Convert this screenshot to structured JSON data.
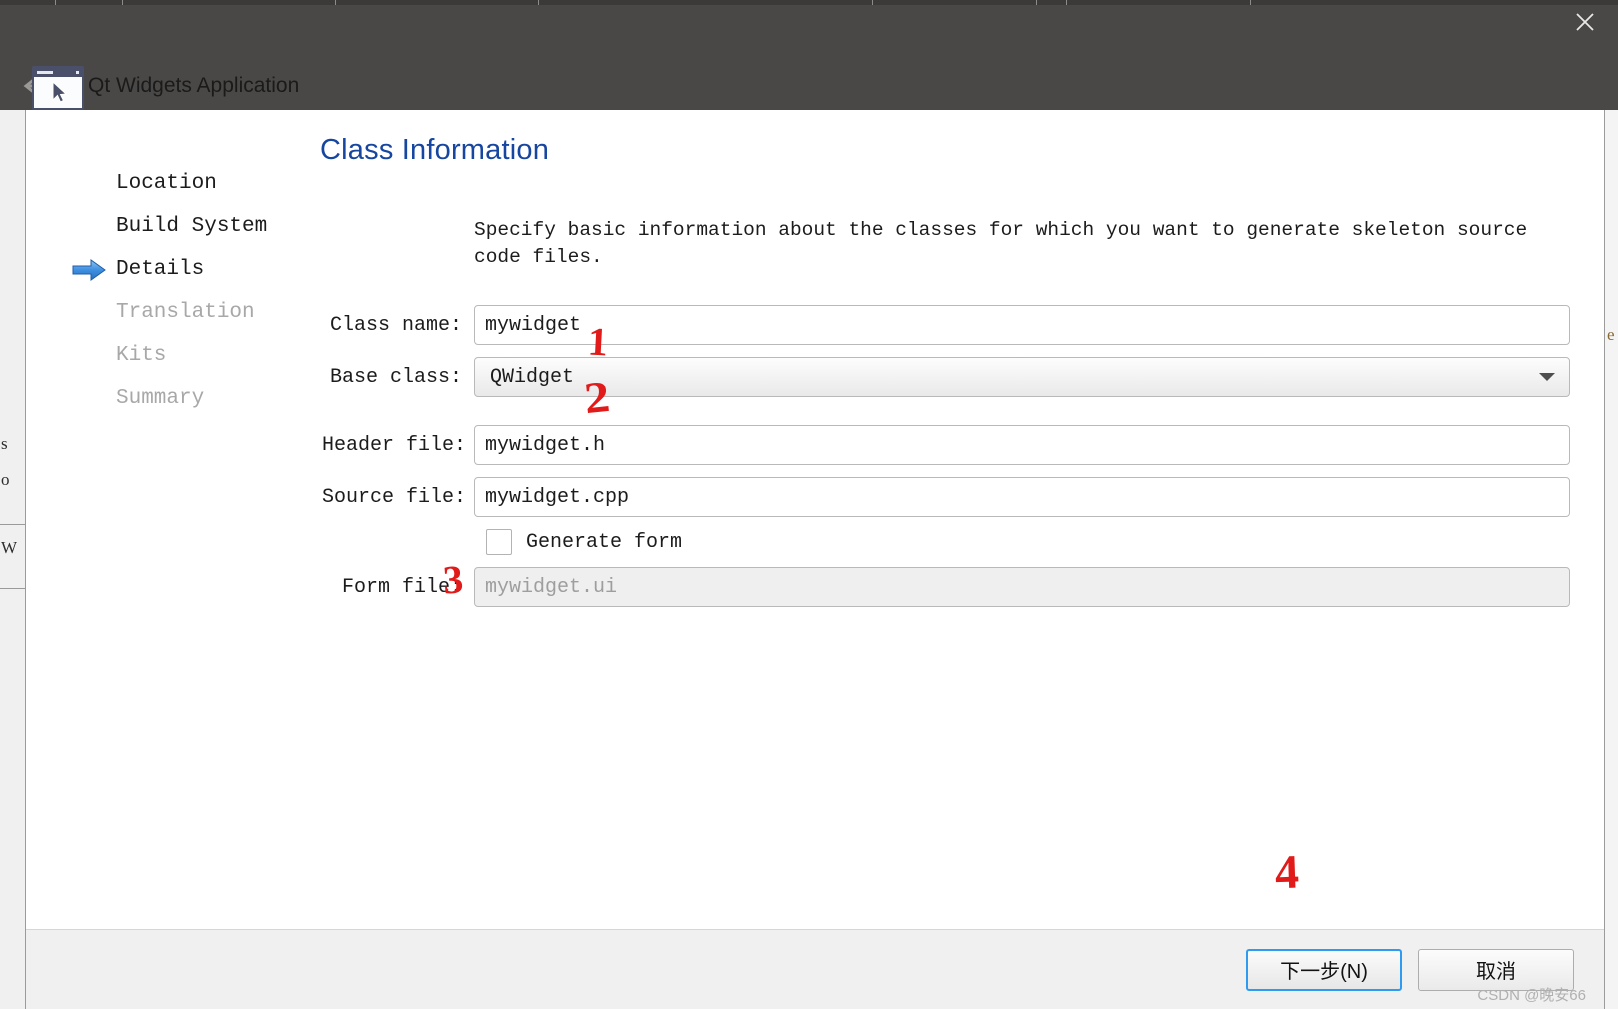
{
  "window": {
    "title": "Qt Widgets Application",
    "close_icon": "close-icon",
    "back_icon": "back-arrow-icon",
    "app_icon": "qt-widgets-app-icon"
  },
  "background": {
    "left_fragments": [
      "s",
      "o",
      "W"
    ],
    "right_fragment": "e"
  },
  "steps": [
    {
      "label": "Location",
      "state": "done"
    },
    {
      "label": "Build System",
      "state": "done"
    },
    {
      "label": "Details",
      "state": "current"
    },
    {
      "label": "Translation",
      "state": "upcoming"
    },
    {
      "label": "Kits",
      "state": "upcoming"
    },
    {
      "label": "Summary",
      "state": "upcoming"
    }
  ],
  "page": {
    "title": "Class Information",
    "description": "Specify basic information about the classes for which you want to generate skeleton source code files."
  },
  "form": {
    "class_name": {
      "label": "Class name:",
      "value": "mywidget"
    },
    "base_class": {
      "label": "Base class:",
      "value": "QWidget",
      "arrow_icon": "chevron-down-icon"
    },
    "header_file": {
      "label": "Header file:",
      "value": "mywidget.h"
    },
    "source_file": {
      "label": "Source file:",
      "value": "mywidget.cpp"
    },
    "generate_form": {
      "label": "Generate form",
      "checked": false
    },
    "form_file": {
      "label": "Form file:",
      "value": "mywidget.ui",
      "disabled": true
    }
  },
  "annotations": [
    {
      "id": "1",
      "text": "1"
    },
    {
      "id": "2",
      "text": "2"
    },
    {
      "id": "3",
      "text": "3"
    },
    {
      "id": "4",
      "text": "4"
    }
  ],
  "footer": {
    "next_label": "下一步(N)",
    "cancel_label": "取消"
  },
  "watermark": "CSDN @晚安66",
  "colors": {
    "title_blue": "#1646a0",
    "dim_bg": "#4a4846",
    "accent_focus": "#2f9bf0",
    "annotation_red": "#e01b19"
  }
}
